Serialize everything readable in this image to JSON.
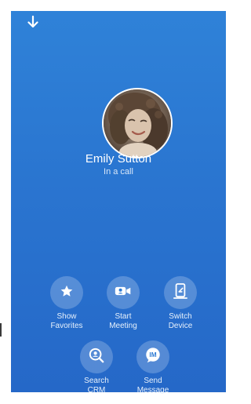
{
  "contact": {
    "name": "Emily Sutton",
    "status": "In a call"
  },
  "actions": [
    {
      "label": "Show\nFavorites",
      "icon": "star-icon"
    },
    {
      "label": "Start\nMeeting",
      "icon": "video-camera-icon"
    },
    {
      "label": "Switch\nDevice",
      "icon": "switch-device-icon"
    },
    {
      "label": "Search\nCRM",
      "icon": "search-crm-icon"
    },
    {
      "label": "Send\nMessage",
      "icon": "message-im-icon"
    }
  ],
  "icons": {
    "collapse": "arrow-down-icon",
    "im_text": "IM"
  },
  "colors": {
    "panel_top": "#2f82d8",
    "panel_bottom": "#2568c8",
    "text": "#ffffff"
  }
}
